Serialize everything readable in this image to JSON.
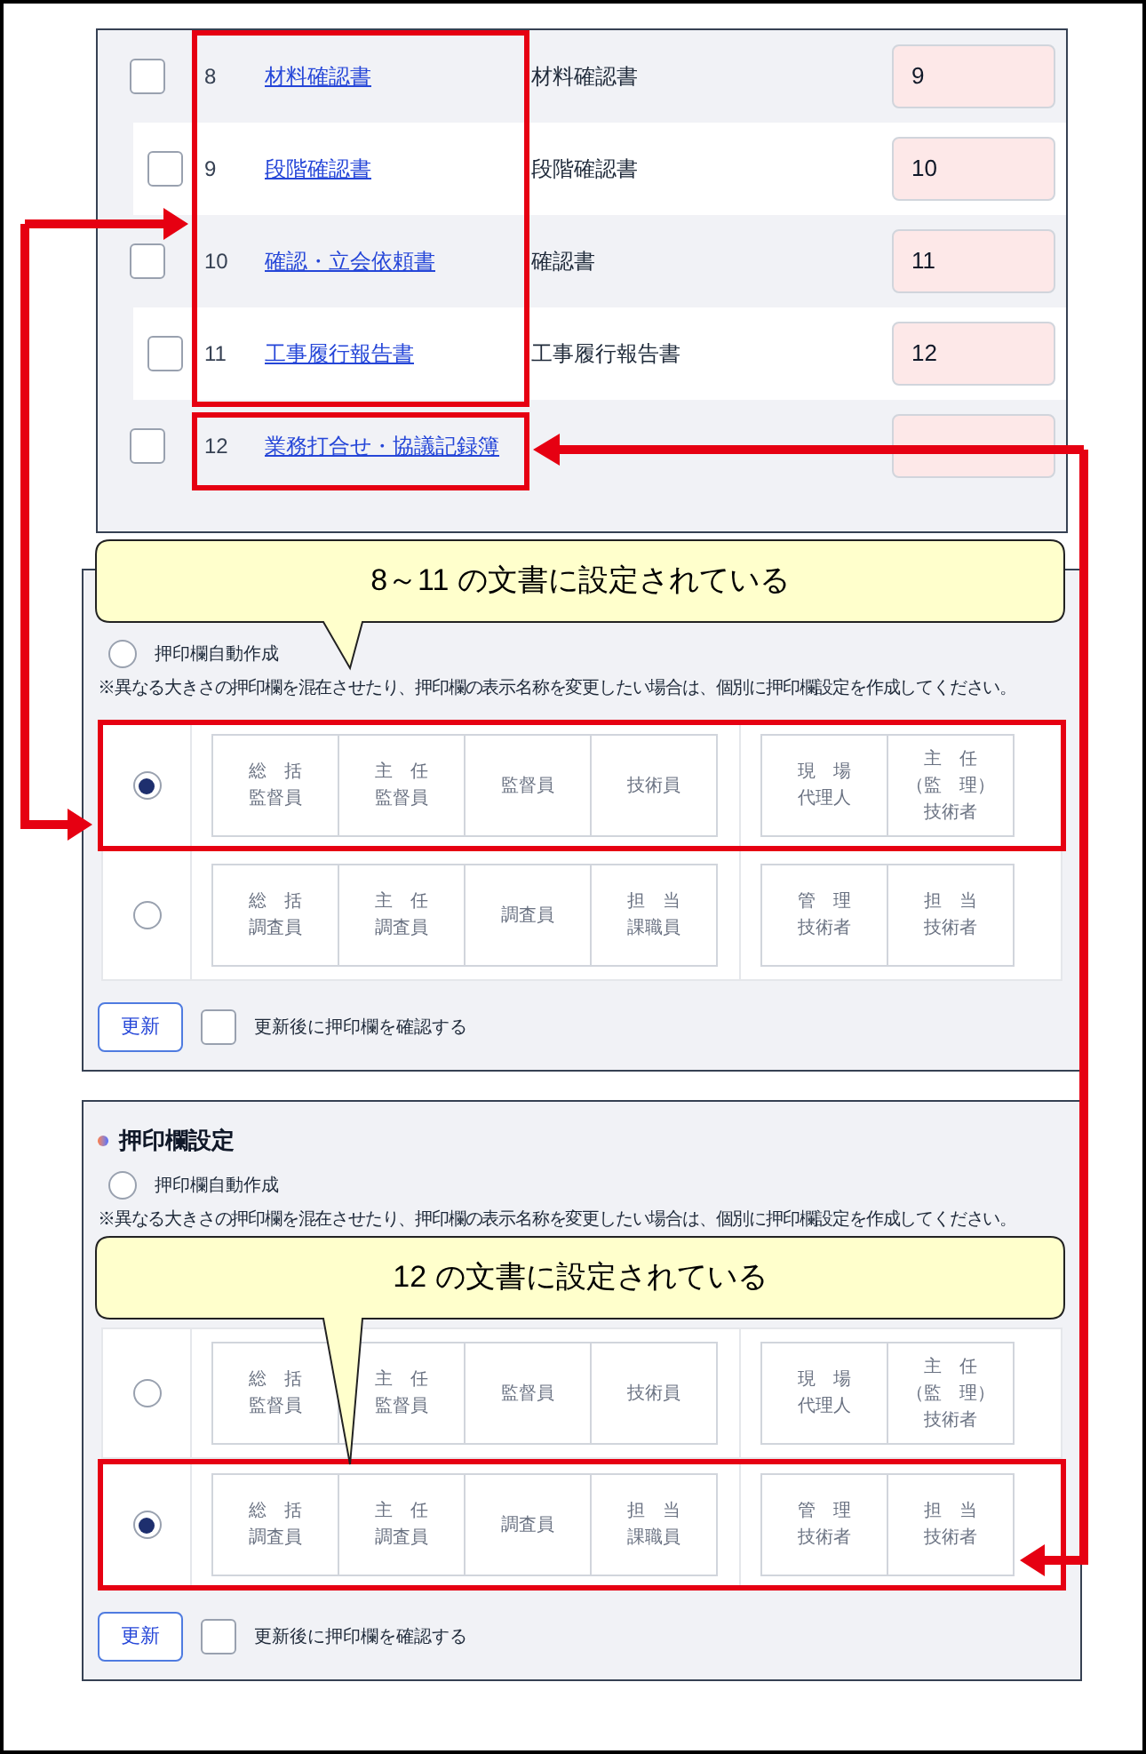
{
  "documents": {
    "rows": [
      {
        "number": "8",
        "link": "材料確認書",
        "description": "材料確認書",
        "value": "9",
        "checked": false
      },
      {
        "number": "9",
        "link": "段階確認書",
        "description": "段階確認書",
        "value": "10",
        "checked": false
      },
      {
        "number": "10",
        "link": "確認・立会依頼書",
        "description": "確認書",
        "value": "11",
        "checked": false
      },
      {
        "number": "11",
        "link": "工事履行報告書",
        "description": "工事履行報告書",
        "value": "12",
        "checked": false
      },
      {
        "number": "12",
        "link": "業務打合せ・協議記録簿",
        "checked": false
      }
    ]
  },
  "panels": [
    {
      "callout": "8～11 の文書に設定されている",
      "auto_option": {
        "label": "押印欄自動作成",
        "selected": false
      },
      "note": "※異なる大きさの押印欄を混在させたり、押印欄の表示名称を変更したい場合は、個別に押印欄設定を作成してください。",
      "stamp_rows": [
        {
          "selected": true,
          "highlighted": true,
          "groups": [
            [
              [
                "総　括",
                "監督員"
              ],
              [
                "主　任",
                "監督員"
              ],
              [
                "監督員"
              ],
              [
                "技術員"
              ]
            ],
            [
              [
                "現　場",
                "代理人"
              ],
              [
                "主　任",
                "（監　理）",
                "技術者"
              ]
            ]
          ]
        },
        {
          "selected": false,
          "highlighted": false,
          "groups": [
            [
              [
                "総　括",
                "調査員"
              ],
              [
                "主　任",
                "調査員"
              ],
              [
                "調査員"
              ],
              [
                "担　当",
                "課職員"
              ]
            ],
            [
              [
                "管　理",
                "技術者"
              ],
              [
                "担　当",
                "技術者"
              ]
            ]
          ]
        }
      ],
      "update_button": "更新",
      "confirm": {
        "label": "更新後に押印欄を確認する",
        "checked": false
      }
    },
    {
      "title": "押印欄設定",
      "callout": "12 の文書に設定されている",
      "auto_option": {
        "label": "押印欄自動作成",
        "selected": false
      },
      "note": "※異なる大きさの押印欄を混在させたり、押印欄の表示名称を変更したい場合は、個別に押印欄設定を作成してください。",
      "stamp_rows": [
        {
          "selected": false,
          "highlighted": false,
          "groups": [
            [
              [
                "総　括",
                "監督員"
              ],
              [
                "主　任",
                "監督員"
              ],
              [
                "監督員"
              ],
              [
                "技術員"
              ]
            ],
            [
              [
                "現　場",
                "代理人"
              ],
              [
                "主　任",
                "（監　理）",
                "技術者"
              ]
            ]
          ]
        },
        {
          "selected": true,
          "highlighted": true,
          "groups": [
            [
              [
                "総　括",
                "調査員"
              ],
              [
                "主　任",
                "調査員"
              ],
              [
                "調査員"
              ],
              [
                "担　当",
                "課職員"
              ]
            ],
            [
              [
                "管　理",
                "技術者"
              ],
              [
                "担　当",
                "技術者"
              ]
            ]
          ]
        }
      ],
      "update_button": "更新",
      "confirm": {
        "label": "更新後に押印欄を確認する",
        "checked": false
      }
    }
  ]
}
